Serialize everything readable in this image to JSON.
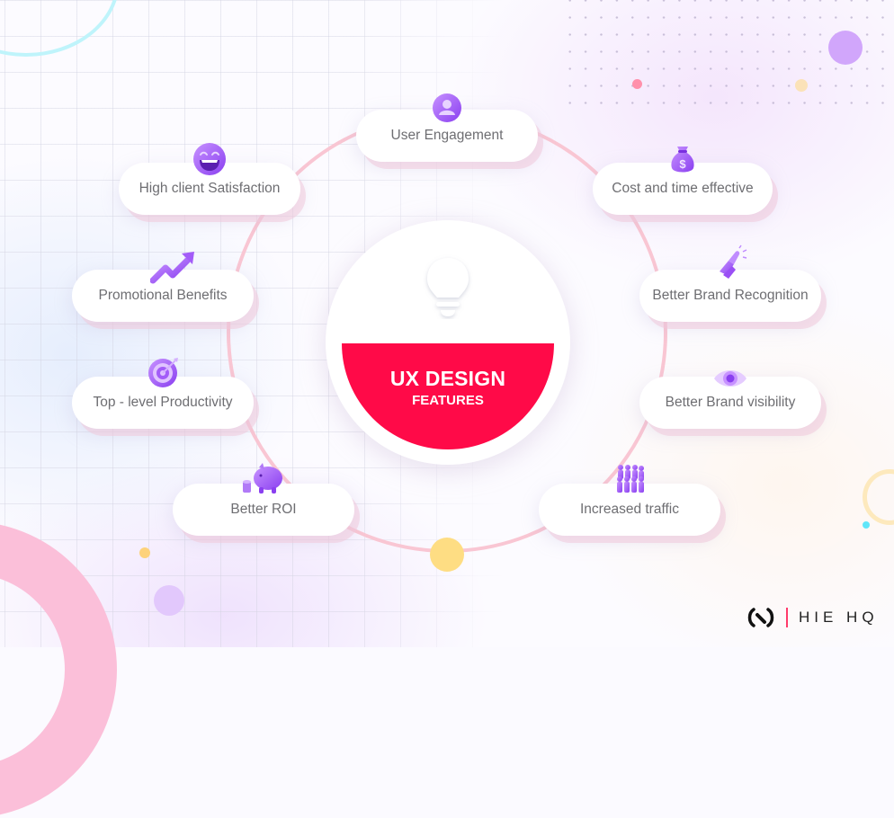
{
  "diagram": {
    "center": {
      "title": "UX DESIGN",
      "subtitle": "FEATURES",
      "icon": "lightbulb-icon",
      "accent_color": "#ff0a48"
    },
    "features": [
      {
        "label": "User Engagement",
        "icon": "user-icon"
      },
      {
        "label": "Cost and time effective",
        "icon": "money-bag-icon"
      },
      {
        "label": "Better Brand Recognition",
        "icon": "clapping-hands-icon"
      },
      {
        "label": "Better Brand visibility",
        "icon": "eye-icon"
      },
      {
        "label": "Increased traffic",
        "icon": "crowd-icon"
      },
      {
        "label": "Better ROI",
        "icon": "piggy-bank-icon"
      },
      {
        "label": "Top - level Productivity",
        "icon": "target-icon"
      },
      {
        "label": "Promotional Benefits",
        "icon": "trending-arrow-icon"
      },
      {
        "label": "High client Satisfaction",
        "icon": "laughing-face-icon"
      }
    ],
    "colors": {
      "ring": "#f9c6d3",
      "icon_purple": "#a855f7",
      "pill_text": "#6e6e72"
    }
  },
  "brand": {
    "name": "HIE HQ",
    "separator_color": "#ff3b6b"
  }
}
